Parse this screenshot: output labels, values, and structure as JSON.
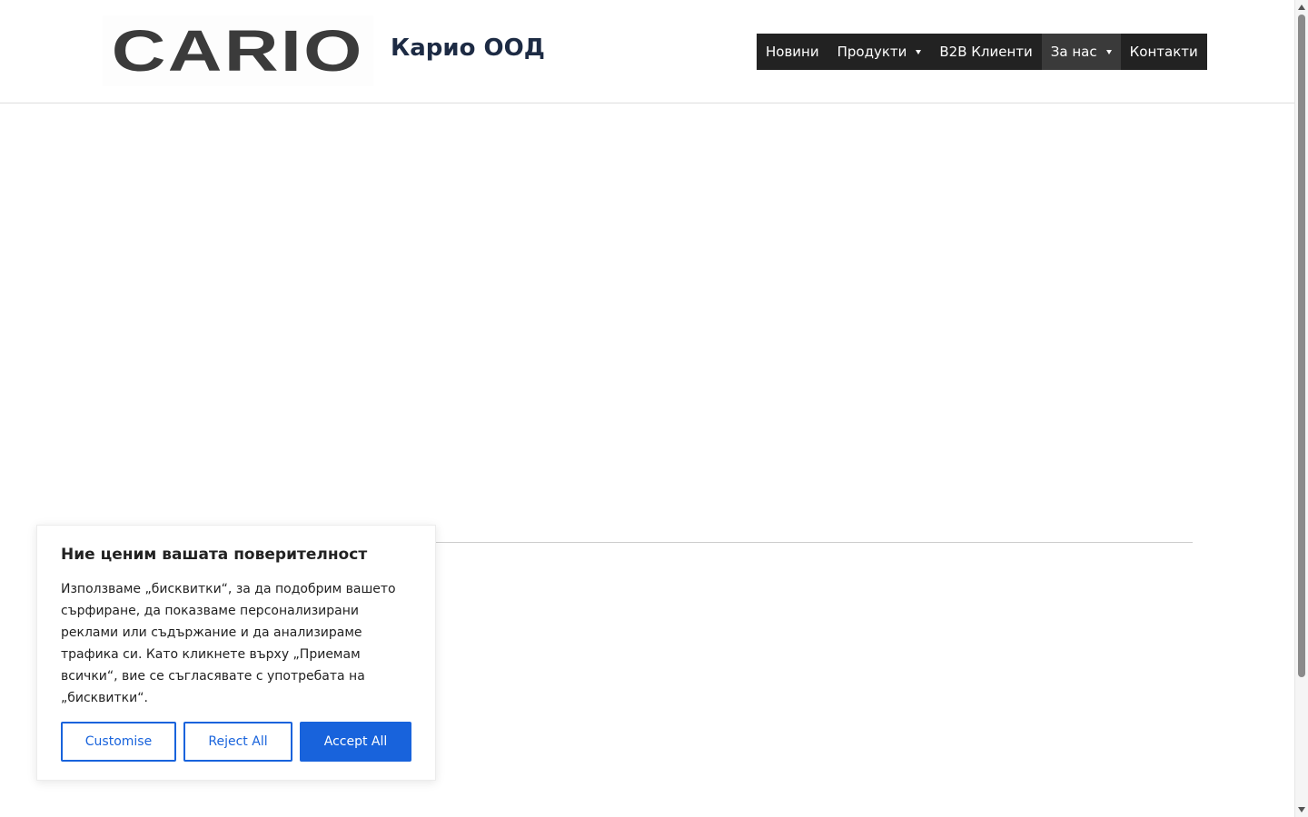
{
  "header": {
    "logo_text": "CARIO",
    "site_title": "Карио ООД",
    "nav": [
      {
        "label": "Новини",
        "has_dropdown": false,
        "active": false
      },
      {
        "label": "Продукти",
        "has_dropdown": true,
        "active": false
      },
      {
        "label": "B2B Клиенти",
        "has_dropdown": false,
        "active": false
      },
      {
        "label": "За нас",
        "has_dropdown": true,
        "active": true
      },
      {
        "label": "Контакти",
        "has_dropdown": false,
        "active": false
      }
    ]
  },
  "cookie_banner": {
    "title": "Ние ценим вашата поверителност",
    "text": "Използваме „бисквитки“, за да подобрим вашето сърфиране, да показваме персонализирани реклами или съдържание и да анализираме трафика си. Като кликнете върху „Приемам всички“, вие се съгласявате с употребата на „бисквитки“.",
    "customise_label": "Customise",
    "reject_label": "Reject All",
    "accept_label": "Accept All"
  },
  "colors": {
    "nav_background": "#222222",
    "nav_active_background": "#3a3a3a",
    "accent_blue": "#1863dc",
    "site_title": "#1d2b44",
    "logo": "#3b3b3b"
  }
}
